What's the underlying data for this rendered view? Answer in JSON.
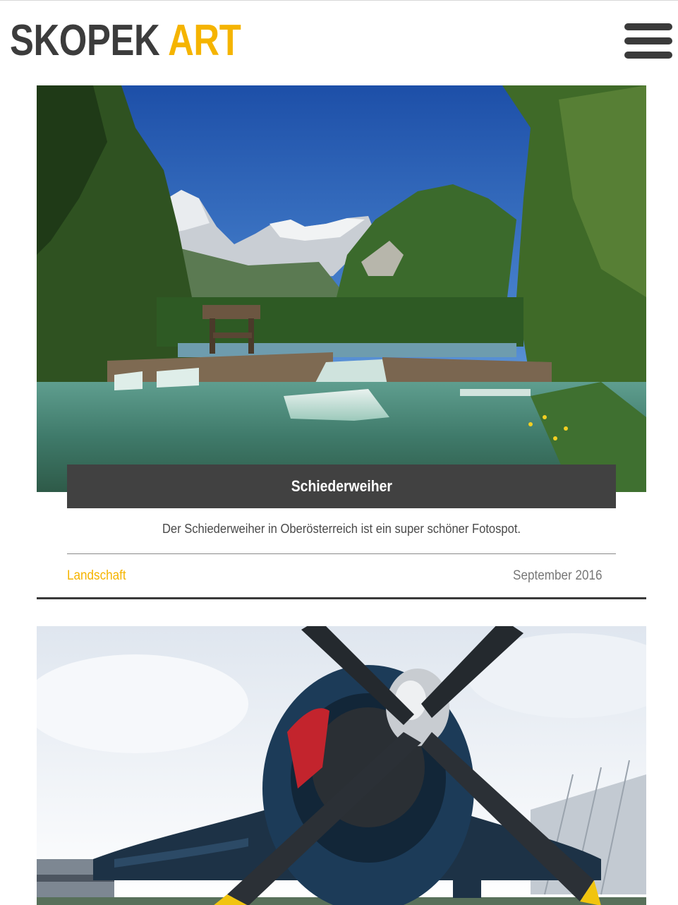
{
  "header": {
    "logo_primary": "SKOPEK",
    "logo_accent": "ART",
    "menu_icon": "hamburger-menu-icon"
  },
  "posts": [
    {
      "title": "Schiederweiher",
      "excerpt": "Der Schiederweiher in Oberösterreich ist ein super schöner Fotospot.",
      "category": "Landschaft",
      "date": "September 2016"
    }
  ],
  "colors": {
    "accent": "#f5b400",
    "logo_dark": "#3c3c3c",
    "title_bar": "#414141",
    "date_text": "#777777"
  }
}
